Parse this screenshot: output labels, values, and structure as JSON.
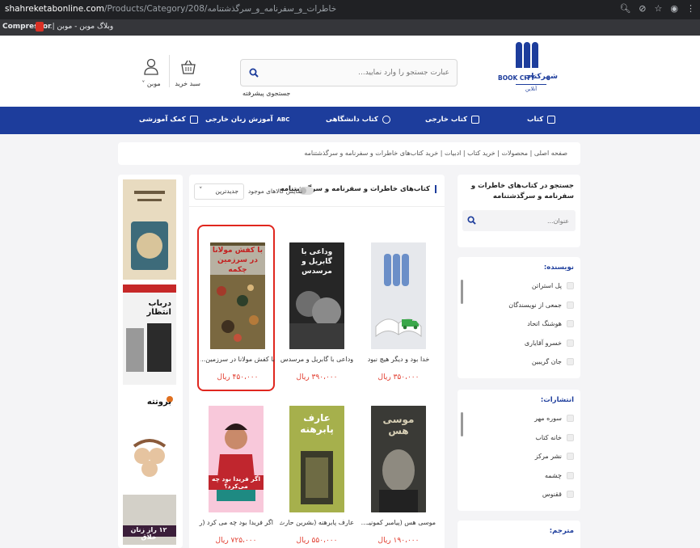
{
  "browser": {
    "url_host": "shahreketabonline.com",
    "url_path": "/Products/Category/208/خاطرات_و_سفرنامه_و_سرگذشتنامه",
    "bookmarks": [
      "Compressor",
      "وبلاگ موبن - موبن |..."
    ]
  },
  "header": {
    "logo_en": "BOOK CITY",
    "logo_fa": "شهرکتاب",
    "logo_sub": "آنلاین",
    "search_placeholder": "عبارت جستجو را وارد نمایید...",
    "advanced_search": "جستجوی پیشرفته",
    "cart_label": "سبد خرید",
    "user_label": "موبن"
  },
  "nav": [
    {
      "label": "کتاب",
      "icon": "book-icon"
    },
    {
      "label": "کتاب خارجی",
      "icon": "book-icon"
    },
    {
      "label": "کتاب دانشگاهی",
      "icon": "graduation-cap-icon"
    },
    {
      "label": "آموزش زبان خارجی",
      "icon": "abc-icon"
    },
    {
      "label": "کمک آموزشی",
      "icon": "notebook-icon"
    }
  ],
  "breadcrumb": "صفحه اصلی  |  محصولات  |  خرید کتاب  |  ادبیات  |  خرید کتاب‌های خاطرات و سفرنامه و سرگذشتنامه",
  "side_search": {
    "title": "جستجو در کتاب‌های خاطرات و سفرنامه و سرگذشتنامه",
    "placeholder": "عنوان..."
  },
  "filters": [
    {
      "title": "نویسنده:",
      "items": [
        "پل استراتن",
        "جمعی از نویسندگان",
        "هوشنگ اتحاد",
        "خسرو آقایاری",
        "جان گریبین"
      ]
    },
    {
      "title": "انتشارات:",
      "items": [
        "سوره مهر",
        "خانه کتاب",
        "نشر مرکز",
        "چشمه",
        "ققنوس"
      ]
    },
    {
      "title": "مترجم:",
      "items": []
    }
  ],
  "products_panel": {
    "title": "کتاب‌های خاطرات و سفرنامه و سرگذشتنامه",
    "toggle_label": "نمایش کالاهای موجود",
    "sort_value": "جدیدترین"
  },
  "products": [
    {
      "name": "خدا بود و دیگر هیچ نبود",
      "price": "۳۵۰،۰۰۰ ریال",
      "cover_text": ""
    },
    {
      "name": "وداعی با گابریل و مرسدس",
      "price": "۳۹۰،۰۰۰ ریال",
      "cover_text": "وداعی با گابریل و مرسدس"
    },
    {
      "name": "با کفش مولانا در سرزمین...",
      "price": "۴۵۰،۰۰۰ ریال",
      "cover_text": "با کفش مولانا در سرزمین چکمه"
    },
    {
      "name": "موسی هس (پیامبر کمونیـ...",
      "price": "۱۹۰،۰۰۰ ریال",
      "cover_text": "موسی هس"
    },
    {
      "name": "عارف پابرهنه (بشرین حارث...",
      "price": "۵۵۰،۰۰۰ ریال",
      "cover_text": "عارف پابرهنه"
    },
    {
      "name": "اگر فریدا بود چه می کرد (را...",
      "price": "۷۲۵،۰۰۰ ریال",
      "cover_text": "اگر فریدا بود چه می‌کرد؟"
    }
  ],
  "ads": [
    "درباب انتظار",
    "بروتته",
    "۱۲ راز زنان خلاق"
  ]
}
